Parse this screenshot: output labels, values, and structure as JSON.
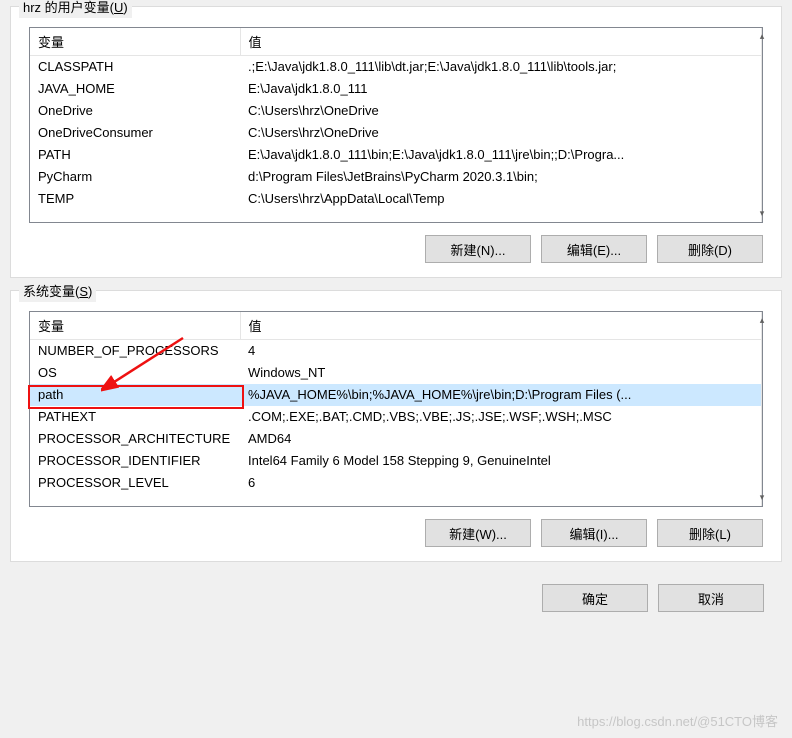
{
  "user_section": {
    "legend_prefix": "hrz 的用户变量(",
    "legend_hotkey": "U",
    "legend_suffix": ")",
    "columns": {
      "name": "变量",
      "value": "值"
    },
    "rows": [
      {
        "name": "CLASSPATH",
        "value": ".;E:\\Java\\jdk1.8.0_111\\lib\\dt.jar;E:\\Java\\jdk1.8.0_111\\lib\\tools.jar;"
      },
      {
        "name": "JAVA_HOME",
        "value": "E:\\Java\\jdk1.8.0_111"
      },
      {
        "name": "OneDrive",
        "value": "C:\\Users\\hrz\\OneDrive"
      },
      {
        "name": "OneDriveConsumer",
        "value": "C:\\Users\\hrz\\OneDrive"
      },
      {
        "name": "PATH",
        "value": "E:\\Java\\jdk1.8.0_111\\bin;E:\\Java\\jdk1.8.0_111\\jre\\bin;;D:\\Progra..."
      },
      {
        "name": "PyCharm",
        "value": "d:\\Program Files\\JetBrains\\PyCharm 2020.3.1\\bin;"
      },
      {
        "name": "TEMP",
        "value": "C:\\Users\\hrz\\AppData\\Local\\Temp"
      }
    ],
    "buttons": {
      "new": "新建(N)...",
      "edit": "编辑(E)...",
      "delete": "删除(D)"
    }
  },
  "system_section": {
    "legend_prefix": "系统变量(",
    "legend_hotkey": "S",
    "legend_suffix": ")",
    "columns": {
      "name": "变量",
      "value": "值"
    },
    "rows": [
      {
        "name": "NUMBER_OF_PROCESSORS",
        "value": "4"
      },
      {
        "name": "OS",
        "value": "Windows_NT"
      },
      {
        "name": "path",
        "value": "%JAVA_HOME%\\bin;%JAVA_HOME%\\jre\\bin;D:\\Program Files (...",
        "selected": true
      },
      {
        "name": "PATHEXT",
        "value": ".COM;.EXE;.BAT;.CMD;.VBS;.VBE;.JS;.JSE;.WSF;.WSH;.MSC"
      },
      {
        "name": "PROCESSOR_ARCHITECTURE",
        "value": "AMD64"
      },
      {
        "name": "PROCESSOR_IDENTIFIER",
        "value": "Intel64 Family 6 Model 158 Stepping 9, GenuineIntel"
      },
      {
        "name": "PROCESSOR_LEVEL",
        "value": "6"
      }
    ],
    "buttons": {
      "new": "新建(W)...",
      "edit": "编辑(I)...",
      "delete": "删除(L)"
    }
  },
  "dialog_buttons": {
    "ok": "确定",
    "cancel": "取消"
  },
  "watermark": "https://blog.csdn.net/@51CTO博客"
}
